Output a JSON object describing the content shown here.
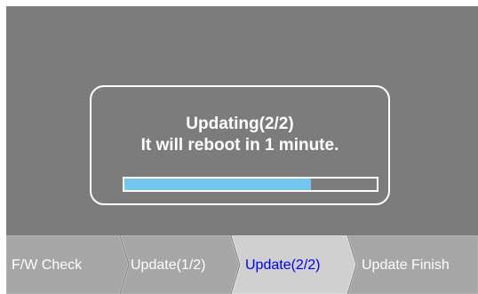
{
  "dialog": {
    "title": "Updating(2/2)",
    "message": "It will reboot in 1 minute.",
    "progress_fraction": 0.74
  },
  "steps": [
    {
      "label": "F/W Check",
      "active": false
    },
    {
      "label": "Update(1/2)",
      "active": false
    },
    {
      "label": "Update(2/2)",
      "active": true
    },
    {
      "label": "Update Finish",
      "active": false
    }
  ],
  "colors": {
    "screen_background": "#7c7c7c",
    "step_background": "#a6a6a6",
    "step_active_background": "#d0d0d0",
    "active_text": "#0000ee",
    "progress_fill": "#73c6ee"
  }
}
